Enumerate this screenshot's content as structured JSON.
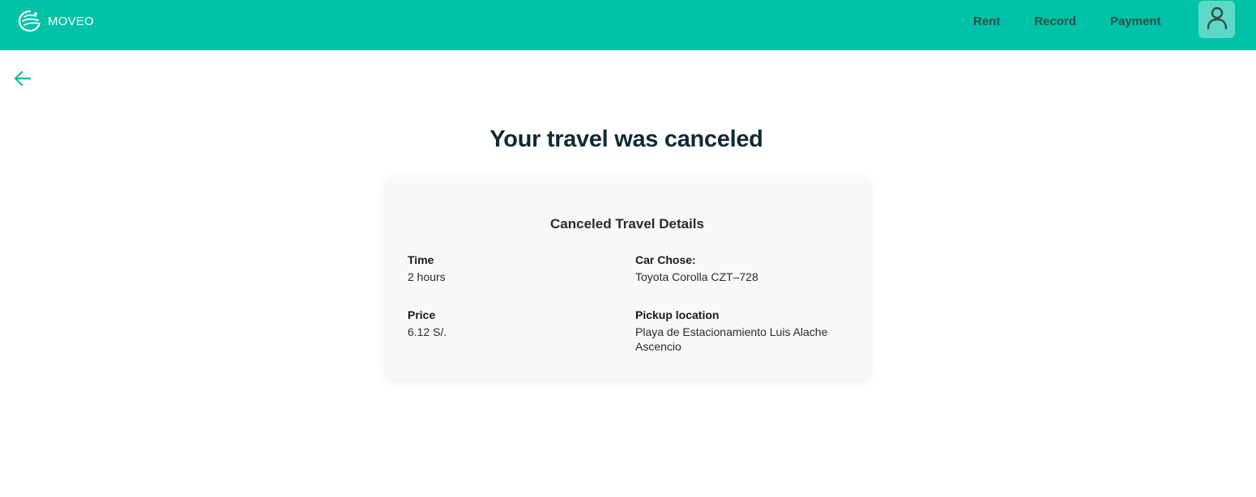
{
  "header": {
    "brand_name": "MOVEO",
    "brand_color": "#00c2a6",
    "nav": [
      {
        "label": "Rent"
      },
      {
        "label": "Record"
      },
      {
        "label": "Payment"
      }
    ],
    "profile_icon": "user-icon"
  },
  "back_icon": "arrow-left-icon",
  "main": {
    "title": "Your travel was canceled",
    "card": {
      "title": "Canceled Travel Details",
      "time": {
        "label": "Time",
        "value": "2 hours"
      },
      "car": {
        "label": "Car Chose:",
        "value": "Toyota Corolla CZT–728"
      },
      "price": {
        "label": "Price",
        "value": "6.12 S/."
      },
      "pickup": {
        "label": "Pickup location",
        "value": "Playa de Estacionamiento Luis Alache Ascencio"
      }
    }
  }
}
